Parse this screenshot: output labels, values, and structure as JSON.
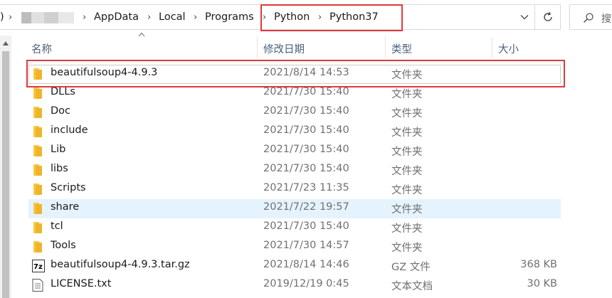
{
  "address_bar": {
    "crumbs": [
      "AppData",
      "Local",
      "Programs",
      "Python",
      "Python37"
    ],
    "leading_fragment": ")"
  },
  "columns": {
    "name": "名称",
    "date": "修改日期",
    "type": "类型",
    "size": "大小"
  },
  "files": [
    {
      "name": "beautifulsoup4-4.9.3",
      "date": "2021/8/14 14:53",
      "type": "文件夹",
      "size": "",
      "icon": "folder-icon"
    },
    {
      "name": "DLLs",
      "date": "2021/7/30 15:40",
      "type": "文件夹",
      "size": "",
      "icon": "folder-icon"
    },
    {
      "name": "Doc",
      "date": "2021/7/30 15:40",
      "type": "文件夹",
      "size": "",
      "icon": "folder-icon"
    },
    {
      "name": "include",
      "date": "2021/7/30 15:40",
      "type": "文件夹",
      "size": "",
      "icon": "folder-icon"
    },
    {
      "name": "Lib",
      "date": "2021/7/30 15:40",
      "type": "文件夹",
      "size": "",
      "icon": "folder-icon"
    },
    {
      "name": "libs",
      "date": "2021/7/30 15:40",
      "type": "文件夹",
      "size": "",
      "icon": "folder-icon"
    },
    {
      "name": "Scripts",
      "date": "2021/7/23 11:35",
      "type": "文件夹",
      "size": "",
      "icon": "folder-icon"
    },
    {
      "name": "share",
      "date": "2021/7/22 19:57",
      "type": "文件夹",
      "size": "",
      "icon": "folder-icon"
    },
    {
      "name": "tcl",
      "date": "2021/7/30 15:40",
      "type": "文件夹",
      "size": "",
      "icon": "folder-icon"
    },
    {
      "name": "Tools",
      "date": "2021/7/30 14:57",
      "type": "文件夹",
      "size": "",
      "icon": "folder-icon"
    },
    {
      "name": "beautifulsoup4-4.9.3.tar.gz",
      "date": "2021/8/14 14:46",
      "type": "GZ 文件",
      "size": "368 KB",
      "icon": "archive-7z-icon"
    },
    {
      "name": "LICENSE.txt",
      "date": "2019/12/19 0:45",
      "type": "文本文档",
      "size": "30 KB",
      "icon": "text-file-icon"
    }
  ],
  "colors": {
    "highlight": "#e03a3a",
    "hover_row": "#e5f3ff",
    "folder": "#f8c843",
    "header_text": "#4c607a"
  }
}
